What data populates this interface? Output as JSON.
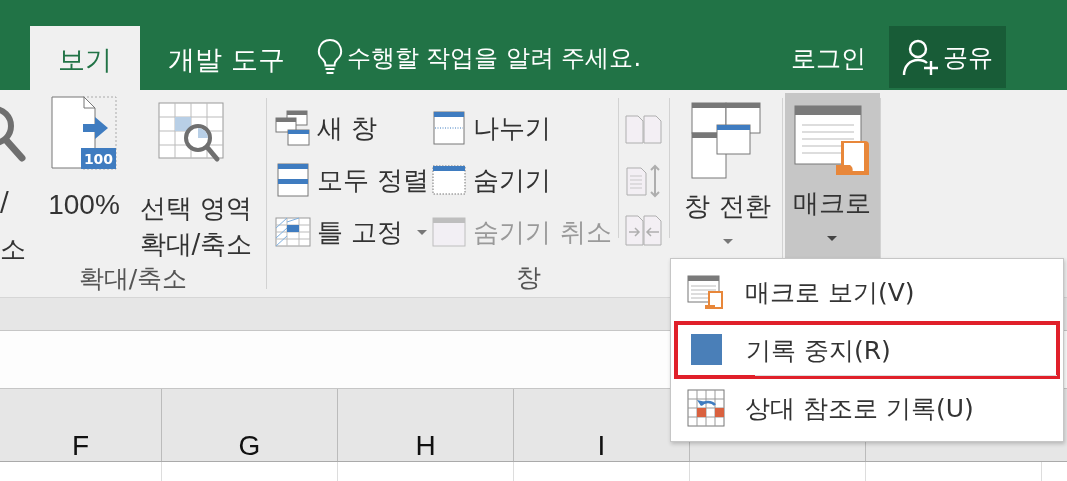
{
  "tabs": [
    {
      "label": "보기",
      "selected": true
    },
    {
      "label": "개발 도구",
      "selected": false
    }
  ],
  "tell_me": {
    "placeholder": "수행할 작업을 알려 주세요."
  },
  "account": {
    "sign_in": "로그인",
    "share": "공유"
  },
  "ribbon": {
    "zoom_group": {
      "label": "확대/축소",
      "buttons": [
        {
          "kind": "zoom",
          "lines": [
            "/",
            "소"
          ]
        },
        {
          "kind": "hundred",
          "icon_text": "100",
          "lines": [
            "100%"
          ]
        },
        {
          "kind": "selection",
          "lines": [
            "선택 영역",
            "확대/축소"
          ]
        }
      ]
    },
    "window_group": {
      "label": "창",
      "columns": [
        [
          {
            "kind": "new-window",
            "label": "새 창",
            "disabled": false,
            "dropdown": false
          },
          {
            "kind": "arrange",
            "label": "모두 정렬",
            "disabled": false,
            "dropdown": false
          },
          {
            "kind": "freeze",
            "label": "틀 고정",
            "disabled": false,
            "dropdown": true
          }
        ],
        [
          {
            "kind": "split",
            "label": "나누기",
            "disabled": false,
            "dropdown": false
          },
          {
            "kind": "hide",
            "label": "숨기기",
            "disabled": false,
            "dropdown": false
          },
          {
            "kind": "unhide",
            "label": "숨기기 취소",
            "disabled": true,
            "dropdown": false
          }
        ]
      ],
      "icon_buttons": [
        {
          "kind": "side-by-side",
          "disabled": true
        },
        {
          "kind": "sync-scroll",
          "disabled": true
        },
        {
          "kind": "reset-position",
          "disabled": true
        }
      ],
      "switch": {
        "label": "창 전환",
        "dropdown": true
      }
    },
    "macro": {
      "label": "매크로",
      "selected": true,
      "dropdown": true
    }
  },
  "columns": [
    "F",
    "G",
    "H",
    "I"
  ],
  "macro_menu": [
    {
      "kind": "view",
      "label": "매크로 보기(V)",
      "highlighted": false
    },
    {
      "kind": "stop",
      "label": "기록 중지(R)",
      "highlighted": true
    },
    {
      "kind": "relative",
      "label": "상대 참조로 기록(U)",
      "highlighted": false
    }
  ]
}
